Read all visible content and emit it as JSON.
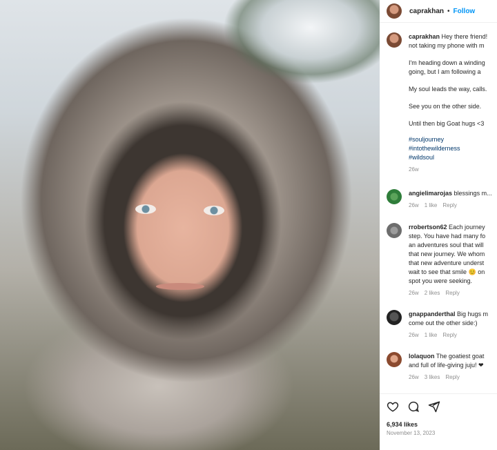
{
  "post": {
    "username": "caprakhan",
    "follow_label": "Follow",
    "separator": "•"
  },
  "caption": {
    "username": "caprakhan",
    "line1": "Hey there friend!",
    "line2": "not taking my phone with m",
    "para2_line1": "I'm heading down a winding",
    "para2_line2": "going, but I am following a",
    "para3": "My soul leads the way, calls.",
    "para4": "See you on the other side.",
    "para5": "Until then big Goat hugs <3",
    "tags": [
      "#souljourney",
      "#intothewilderness",
      "#wildsoul"
    ],
    "age": "26w"
  },
  "comments": [
    {
      "username": "angielimarojas",
      "lines": [
        "blessings m..."
      ],
      "age": "26w",
      "likes": "1 like",
      "reply": "Reply"
    },
    {
      "username": "rrobertson62",
      "lines": [
        "Each journey",
        "step. You have had many fo",
        "an adventures soul that will",
        "that new journey. We whom",
        "that new adventure underst",
        "wait to see that smile 😊 on",
        "spot you were seeking."
      ],
      "age": "26w",
      "likes": "2 likes",
      "reply": "Reply"
    },
    {
      "username": "gnappanderthal",
      "lines": [
        "Big hugs m",
        "come out the other side:)"
      ],
      "age": "26w",
      "likes": "1 like",
      "reply": "Reply"
    },
    {
      "username": "lolaquon",
      "lines": [
        "The goatiest goat",
        "and full of life-giving juju! ❤"
      ],
      "age": "26w",
      "likes": "3 likes",
      "reply": "Reply"
    }
  ],
  "footer": {
    "likes": "6,934 likes",
    "date": "November 13, 2023"
  },
  "icons": {
    "like": "heart-icon",
    "comment": "comment-icon",
    "share": "share-icon"
  },
  "colors": {
    "follow": "#0095f6",
    "hashtag": "#00376b",
    "muted": "#8e8e8e"
  }
}
